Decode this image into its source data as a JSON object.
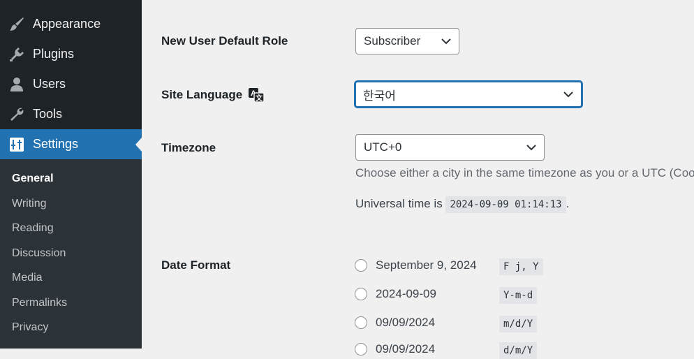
{
  "sidebar": {
    "menu": [
      {
        "label": "Appearance",
        "icon": "paintbrush-icon"
      },
      {
        "label": "Plugins",
        "icon": "plug-icon"
      },
      {
        "label": "Users",
        "icon": "user-icon"
      },
      {
        "label": "Tools",
        "icon": "wrench-icon"
      },
      {
        "label": "Settings",
        "icon": "settings-icon",
        "active": true
      }
    ],
    "submenu": [
      "General",
      "Writing",
      "Reading",
      "Discussion",
      "Media",
      "Permalinks",
      "Privacy"
    ],
    "current_submenu": "General"
  },
  "settings": {
    "default_role": {
      "label": "New User Default Role",
      "value": "Subscriber"
    },
    "site_language": {
      "label": "Site Language",
      "value": "한국어",
      "icon": "translation-icon"
    },
    "timezone": {
      "label": "Timezone",
      "value": "UTC+0",
      "description": "Choose either a city in the same timezone as you or a UTC (Coo",
      "universal_prefix": "Universal time is",
      "universal_time": "2024-09-09 01:14:13",
      "universal_suffix": "."
    },
    "date_format": {
      "label": "Date Format",
      "options": [
        {
          "display": "September 9, 2024",
          "format": "F j, Y"
        },
        {
          "display": "2024-09-09",
          "format": "Y-m-d"
        },
        {
          "display": "09/09/2024",
          "format": "m/d/Y"
        },
        {
          "display": "09/09/2024",
          "format": "d/m/Y"
        }
      ]
    }
  },
  "colors": {
    "sidebar_bg": "#1d2327",
    "submenu_bg": "#2c3338",
    "accent": "#2271b1",
    "page_bg": "#f0f0f1"
  }
}
